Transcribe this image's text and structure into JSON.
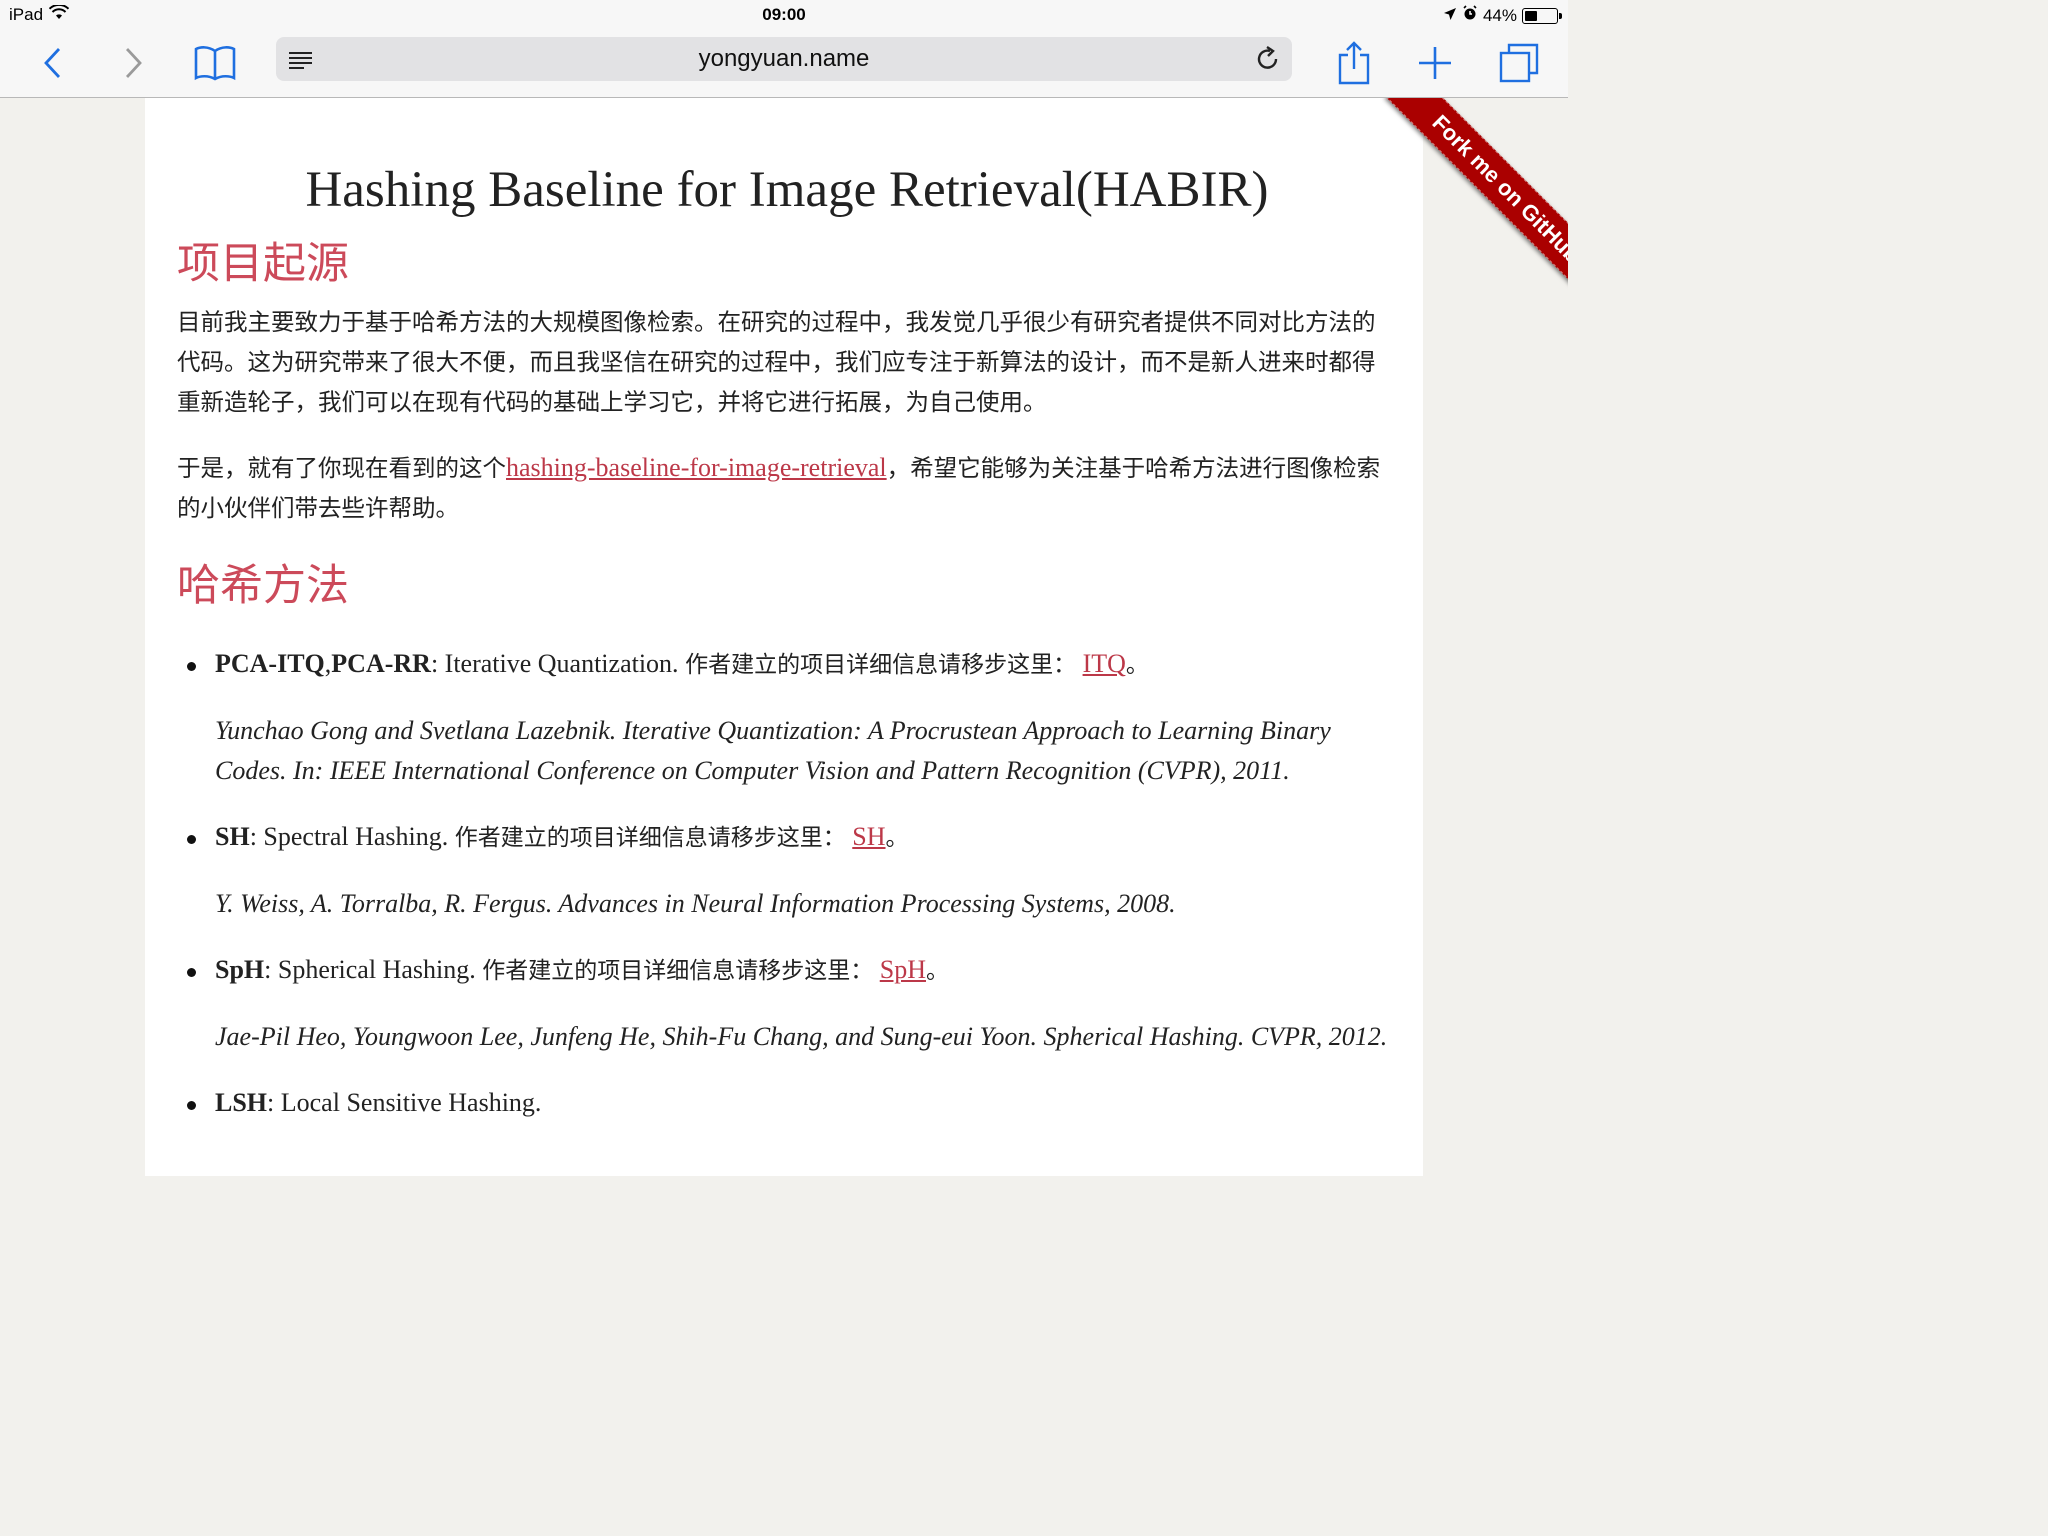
{
  "status_bar": {
    "device": "iPad",
    "time": "09:00",
    "battery": "44%",
    "battery_level": 0.44
  },
  "toolbar": {
    "url": "yongyuan.name",
    "icons": [
      "back-icon",
      "forward-icon",
      "bookmarks-icon",
      "reader-icon",
      "reload-icon",
      "share-icon",
      "add-icon",
      "tabs-icon"
    ]
  },
  "ribbon": {
    "label": "Fork me on GitHub"
  },
  "page": {
    "title": "Hashing Baseline for Image Retrieval(HABIR)",
    "section1": {
      "heading": "项目起源",
      "para1": "目前我主要致力于基于哈希方法的大规模图像检索。在研究的过程中，我发觉几乎很少有研究者提供不同对比方法的代码。这为研究带来了很大不便，而且我坚信在研究的过程中，我们应专注于新算法的设计，而不是新人进来时都得重新造轮子，我们可以在现有代码的基础上学习它，并将它进行拓展，为自己使用。",
      "para2_before": "于是，就有了你现在看到的这个",
      "para2_link": "hashing-baseline-for-image-retrieval",
      "para2_after": "，希望它能够为关注基于哈希方法进行图像检索的小伙伴们带去些许帮助。"
    },
    "section2": {
      "heading": "哈希方法",
      "items": [
        {
          "name1": "PCA-ITQ",
          "sep": ",",
          "name2": "PCA-RR",
          "desc": ": Iterative Quantization. ",
          "cn": "作者建立的项目详细信息请移步这里：",
          "link": "ITQ",
          "end": "。",
          "ref": "Yunchao Gong and Svetlana Lazebnik. Iterative Quantization: A Procrustean Approach to Learning Binary Codes. In: IEEE International Conference on Computer Vision and Pattern Recognition (CVPR), 2011."
        },
        {
          "name1": "SH",
          "desc": ": Spectral Hashing. ",
          "cn": "作者建立的项目详细信息请移步这里：",
          "link": "SH",
          "end": "。",
          "ref": "Y. Weiss, A. Torralba, R. Fergus. Advances in Neural Information Processing Systems, 2008."
        },
        {
          "name1": "SpH",
          "desc": ": Spherical Hashing. ",
          "cn": "作者建立的项目详细信息请移步这里：",
          "link": "SpH",
          "end": "。",
          "ref": "Jae-Pil Heo, Youngwoon Lee, Junfeng He, Shih-Fu Chang, and Sung-eui Yoon. Spherical Hashing. CVPR, 2012."
        },
        {
          "name1": "LSH",
          "desc": ": Local Sensitive Hashing. ",
          "cn": "",
          "link": "",
          "end": "",
          "ref": ""
        }
      ]
    }
  }
}
